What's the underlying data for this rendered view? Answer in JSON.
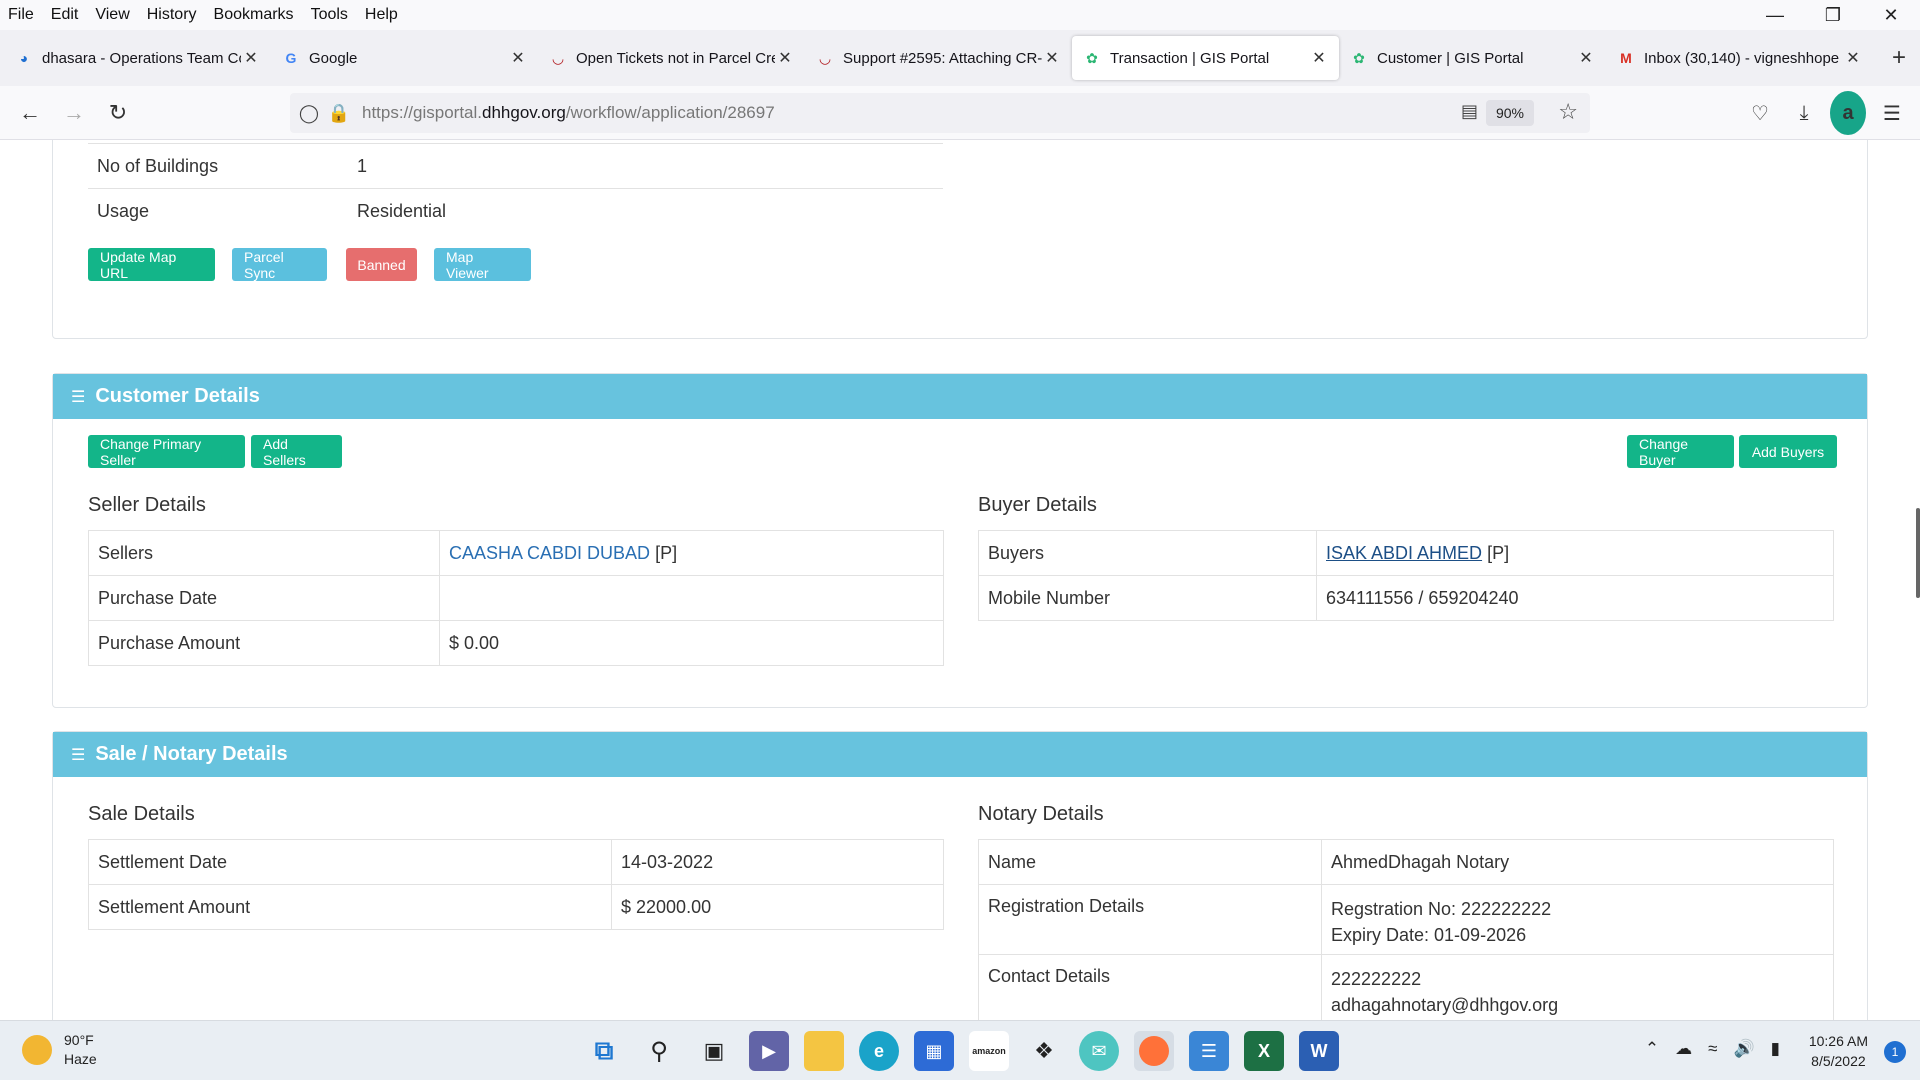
{
  "menubar": {
    "items": [
      "File",
      "Edit",
      "View",
      "History",
      "Bookmarks",
      "Tools",
      "Help"
    ],
    "accel": [
      "F",
      "E",
      "V",
      "s",
      "B",
      "T",
      "H"
    ]
  },
  "tabs": [
    {
      "title": "dhasara - Operations Team Co",
      "icon": "jira-icon"
    },
    {
      "title": "Google",
      "icon": "google-icon"
    },
    {
      "title": "Open Tickets not in Parcel Cre",
      "icon": "redmine-icon"
    },
    {
      "title": "Support #2595: Attaching CR-",
      "icon": "redmine-icon"
    },
    {
      "title": "Transaction | GIS Portal",
      "icon": "gis-portal-icon",
      "active": true
    },
    {
      "title": "Customer | GIS Portal",
      "icon": "gis-portal-icon"
    },
    {
      "title": "Inbox (30,140) - vigneshhope",
      "icon": "gmail-icon"
    }
  ],
  "navbar": {
    "url_prefix": "https://gisportal.",
    "url_domain": "dhhgov.org",
    "url_path": "/workflow/application/28697",
    "zoom": "90%",
    "account_initial": "a"
  },
  "property": {
    "rows": [
      {
        "label": "No of Buildings",
        "value": "1"
      },
      {
        "label": "Usage",
        "value": "Residential"
      }
    ],
    "buttons": {
      "update_map": "Update Map URL",
      "parcel_sync": "Parcel Sync",
      "banned": "Banned",
      "map_viewer": "Map Viewer"
    }
  },
  "customer": {
    "header": "Customer Details",
    "buttons": {
      "change_primary_seller": "Change Primary Seller",
      "add_sellers": "Add Sellers",
      "change_buyer": "Change Buyer",
      "add_buyers": "Add Buyers"
    },
    "seller_title": "Seller Details",
    "seller": {
      "sellers_label": "Sellers",
      "seller_name": "CAASHA CABDI DUBAD",
      "seller_tag": " [P]",
      "purchase_date_label": "Purchase Date",
      "purchase_date": "",
      "purchase_amount_label": "Purchase Amount",
      "purchase_amount": "$ 0.00"
    },
    "buyer_title": "Buyer Details",
    "buyer": {
      "buyers_label": "Buyers",
      "buyer_name": "ISAK ABDI AHMED",
      "buyer_tag": " [P]",
      "mobile_label": "Mobile Number",
      "mobile": "634111556 / 659204240"
    }
  },
  "sale": {
    "header": "Sale / Notary Details",
    "sale_title": "Sale Details",
    "settlement_date_label": "Settlement Date",
    "settlement_date": "14-03-2022",
    "settlement_amount_label": "Settlement Amount",
    "settlement_amount": "$ 22000.00",
    "notary_title": "Notary Details",
    "name_label": "Name",
    "name": "AhmedDhagah Notary",
    "registration_label": "Registration Details",
    "registration_no": "Regstration No: 222222222",
    "expiry": "Expiry Date: 01-09-2026",
    "contact_label": "Contact Details",
    "contact_phone": "222222222",
    "contact_email": "adhagahnotary@dhhgov.org"
  },
  "taskbar": {
    "temp": "90°F",
    "weather": "Haze",
    "time": "10:26 AM",
    "date": "8/5/2022",
    "notifications": "1"
  }
}
